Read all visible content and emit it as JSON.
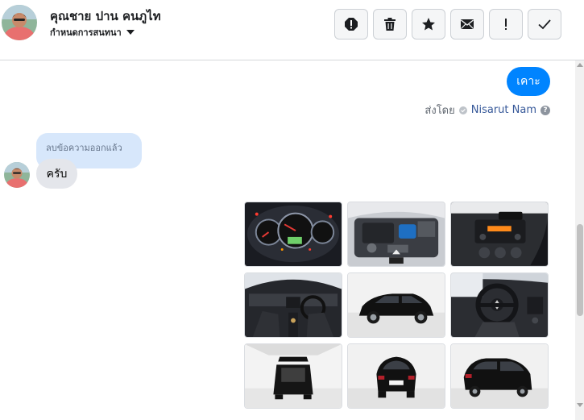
{
  "header": {
    "contact_name": "คุณชาย ปาน คนภูไท",
    "conversation_settings": "กำหนดการสนทนา",
    "actions": [
      {
        "icon": "spam-alert-icon"
      },
      {
        "icon": "trash-icon"
      },
      {
        "icon": "star-icon"
      },
      {
        "icon": "envelope-icon"
      },
      {
        "icon": "exclamation-icon"
      },
      {
        "icon": "checkmark-icon"
      }
    ]
  },
  "messages": {
    "outgoing_text": "เคาะ",
    "sent_by_label": "ส่งโดย",
    "sent_by_name": "Nisarut Nam",
    "deleted_notice": "ลบข้อความออกแล้ว",
    "incoming_text": "ครับ"
  },
  "photos": [
    {
      "subject": "instrument-cluster"
    },
    {
      "subject": "engine-bay"
    },
    {
      "subject": "center-console"
    },
    {
      "subject": "dashboard-interior"
    },
    {
      "subject": "car-side"
    },
    {
      "subject": "steering-wheel"
    },
    {
      "subject": "open-trunk"
    },
    {
      "subject": "car-rear"
    },
    {
      "subject": "car-rear-three-quarter"
    }
  ],
  "colors": {
    "accent_blue": "#0084ff",
    "incoming_bubble": "#e4e6eb",
    "deleted_bubble": "#d7e7fb",
    "link_blue": "#365899"
  }
}
